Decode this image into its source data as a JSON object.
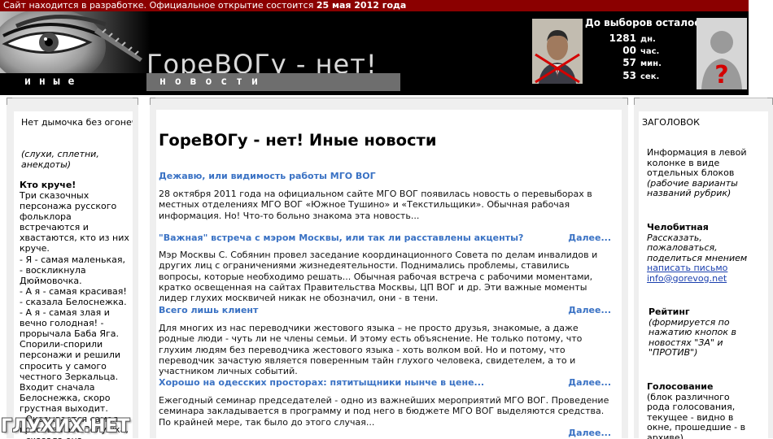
{
  "notice": {
    "text": "Сайт находится в разработке. Официальное открытие состоится ",
    "date": "25 мая 2012 года"
  },
  "header": {
    "logo_title": "ГореВОГу - нет!",
    "logo_subtitle_left": "иные",
    "logo_subtitle_right": "новости",
    "countdown_title": "До выборов осталось:",
    "countdown": [
      {
        "value": "1281",
        "unit": "дн."
      },
      {
        "value": "00",
        "unit": "час."
      },
      {
        "value": "57",
        "unit": "мин."
      },
      {
        "value": "53",
        "unit": "сек."
      }
    ]
  },
  "left": {
    "heading": "Нет дымочка без огонечка",
    "tagline": "(слухи, сплетни, анекдоты)",
    "story_title": "Кто круче!",
    "story": "Три сказочных персонажа русского фольклора встречаются и хвастаются, кто из них круче.\n- Я - самая маленькая, - воскликнула Дюймовочка.\n- А я - самая красивая! - сказала Белоснежка.\n- А я - самая злая и вечно голодная! - прорычала Баба Яга.\nСпорили-спорили персонажи и решили спросить у самого честного Зеркальца.\nВходит сначала Белоснежка, скоро грустная выходит.\n- Оказывается самая красивая это Золушка, - сказала она.\nВходит затем"
  },
  "center": {
    "title": "ГореВОГу - нет! Иные новости",
    "more_label": "Далее...",
    "news": [
      {
        "title": "Дежавю, или видимость работы МГО ВОГ",
        "text": "28 октября 2011 года на официальном сайте МГО ВОГ появилась новость о перевыборах в местных отделениях МГО ВОГ «Южное Тушино» и «Текстильщики». Обычная рабочая информация. Но! Что-то больно знакома эта новость..."
      },
      {
        "title": "\"Важная\" встреча с мэром Москвы, или так ли расставлены акценты?",
        "text": "Мэр Москвы С. Собянин провел заседание координационного Совета по делам инвалидов и других лиц с ограничениями жизнедеятельности. Поднимались проблемы, ставились вопросы, которые необходимо решать... Обычная рабочая встреча с рабочими моментами, кратко освещенная на сайтах Правительства Москвы, ЦП ВОГ и др. Эти важные моменты лидер глухих москвичей никак не обозначил, они - в тени."
      },
      {
        "title": "Всего лишь клиент",
        "text": "Для многих из нас переводчики жестового языка – не просто друзья, знакомые, а даже родные люди - чуть ли не члены семьи. И этому есть объяснение. Не только потому, что глухим людям без переводчика жестового языка - хоть волком вой. Но и потому, что переводчик зачастую является поверенным тайн глухого человека, свидетелем, а то и участником личных событий."
      },
      {
        "title": "Хорошо на одесских просторах: пятитыщники нынче в цене...",
        "text": "Ежегодный семинар председателей - одно из важнейших мероприятий МГО ВОГ. Проведение семинара закладывается в программу и под него в бюджете МГО ВОГ выделяются средства. По крайней мере, так было до этого случая..."
      }
    ]
  },
  "right": {
    "heading": "ЗАГОЛОВОК",
    "info_text": "Информация в левой колонке в виде отдельных блоков",
    "info_italic": "(рабочие варианты названий рубрик)",
    "petition_title": "Челобитная",
    "petition_text": "Рассказать, пожаловаться, поделиться мнением",
    "petition_link": "написать письмо",
    "petition_email": "info@gorevog.net",
    "rating_title": "Рейтинг",
    "rating_text": "(формируется по нажатию кнопок в новостях \"ЗА\" и \"ПРОТИВ\")",
    "vote_title": "Голосование",
    "vote_text": "(блок различного рода голосования, текущее - видно в окне, прошедшие - в архиве)"
  },
  "watermark": "ГЛУХИХ.НЕТ",
  "colors": {
    "notice_bg": "#8b0000",
    "header_bg": "#000000",
    "link_blue": "#3a72c4",
    "column_frame": "#efefef"
  }
}
